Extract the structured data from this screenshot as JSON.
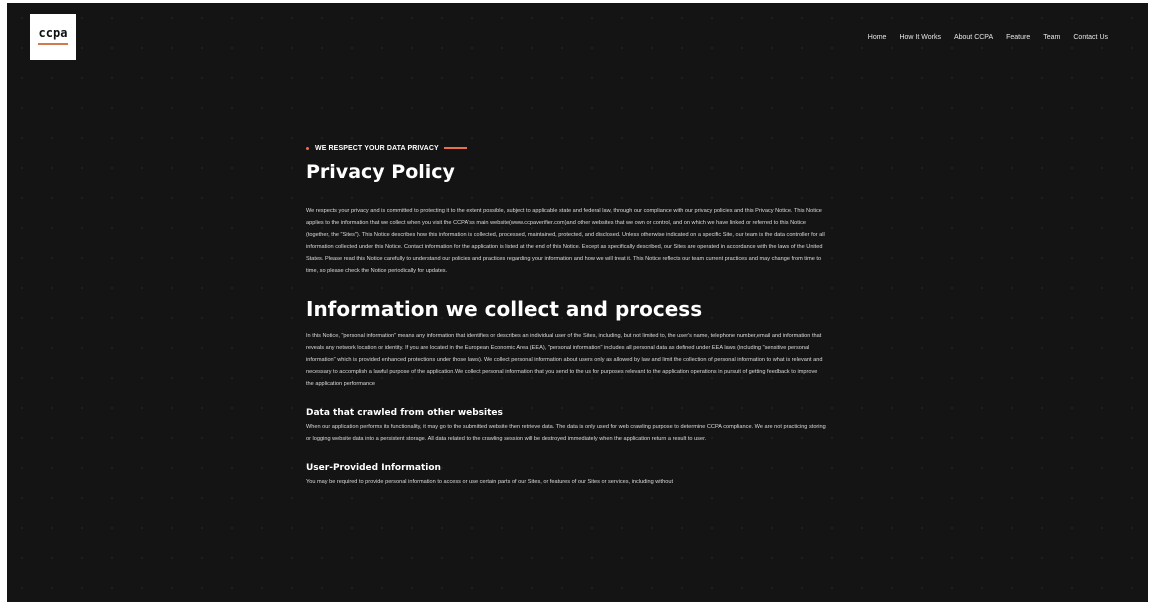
{
  "logo": {
    "text": "ccpa"
  },
  "nav": {
    "items": [
      {
        "label": "Home"
      },
      {
        "label": "How It Works"
      },
      {
        "label": "About CCPA"
      },
      {
        "label": "Feature"
      },
      {
        "label": "Team"
      },
      {
        "label": "Contact Us"
      }
    ]
  },
  "colors": {
    "accent": "#e8704a",
    "background": "#141414"
  },
  "policy": {
    "eyebrow": "WE RESPECT YOUR DATA PRIVACY",
    "title": "Privacy Policy",
    "intro": "We respects your privacy and is committed to protecting it to the extent possible, subject to applicable state and federal law, through our compliance with our privacy policies and this Privacy Notice. This Notice applies to the information that we collect when you visit the CCPA'ss main website(www.ccpaverifier.com)and other websites that we own or control, and on which we have linked or referred to this Notice (together, the \"Sites\"). This Notice describes how this information is collected, processed, maintained, protected, and disclosed. Unless otherwise indicated on a specific Site, our team is the data controller for all information collected under this Notice. Contact information for the application is listed at the end of this Notice. Except as specifically described, our Sites are operated in accordance with the laws of the United States. Please read this Notice carefully to understand our policies and practices regarding your information and how we will treat it. This Notice reflects our team current practices and may change from time to time, so please check the Notice periodically for updates.",
    "section_title": "Information we collect and process",
    "section_body": "In this Notice, \"personal information\" means any information that identifies or describes an individual user of the Sites, including, but not limited to, the user's name, telephone number,email and information that reveals any network location or identity. If you are located in the European Economic Area (EEA), \"personal information\" includes all personal data as defined under EEA laws (including \"sensitive personal information\" which is provided enhanced protections under those laws). We collect personal information about users only as allowed by law and limit the collection of personal information to what is relevant and necessary to accomplish a lawful purpose of the application.We collect personal information that you send to the us for purposes relevant to the application operations in pursuit of getting feedback to improve the application performance",
    "crawl_title": "Data that crawled from other websites",
    "crawl_body": "When our application performs its functionality, it may go to the submitted website then retrieve data. The data is only used for web crawling purpose to determine CCPA compliance. We are not practicing storing or logging website data into a persistent storage. All data related to the crawling session will be destroyed immediately when the application return a result to user.",
    "user_title": "User-Provided Information",
    "user_body": "You may be required to provide personal information to access or use certain parts of our Sites, or features of our Sites or services, including without"
  }
}
